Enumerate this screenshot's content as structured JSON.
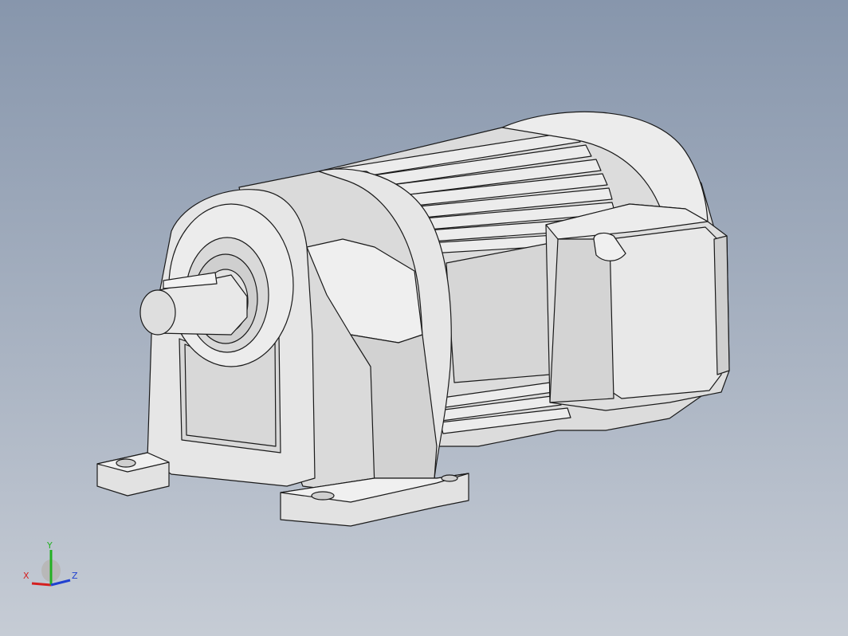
{
  "view": {
    "background_top": "#8796ac",
    "background_bottom": "#c6ccd5",
    "model_face_color": "#e4e4e4",
    "model_shade_color": "#c9c9c9",
    "edge_color": "#1a1a1a"
  },
  "triad": {
    "x_label": "X",
    "y_label": "Y",
    "z_label": "Z",
    "x_color": "#d42020",
    "y_color": "#22b022",
    "z_color": "#2040d0"
  }
}
